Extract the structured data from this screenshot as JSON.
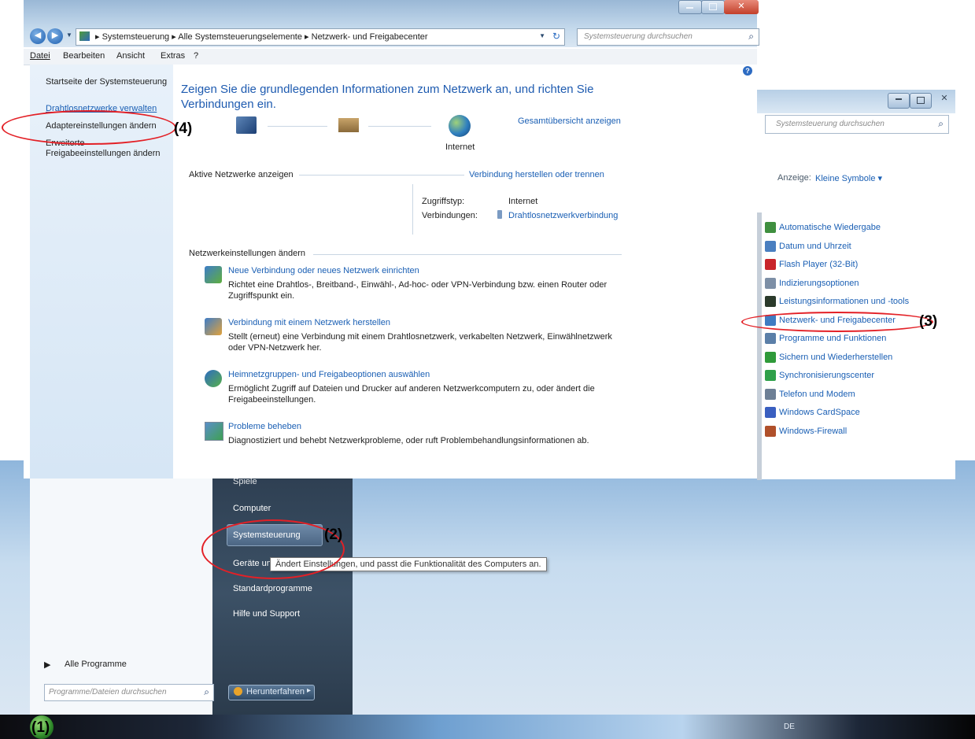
{
  "main_window": {
    "breadcrumb": [
      "Systemsteuerung",
      "Alle Systemsteuerungselemente",
      "Netzwerk- und Freigabecenter"
    ],
    "search_placeholder": "Systemsteuerung durchsuchen",
    "menu": [
      "Datei",
      "Bearbeiten",
      "Ansicht",
      "Extras",
      "?"
    ],
    "sidebar": {
      "items": [
        "Startseite der Systemsteuerung",
        "Drahtlosnetzwerke verwalten",
        "Adaptereinstellungen ändern",
        "Erweiterte",
        "Freigabeeinstellungen ändern"
      ]
    },
    "heading_line1": "Zeigen Sie die grundlegenden Informationen zum Netzwerk an, und richten Sie",
    "heading_line2": "Verbindungen ein.",
    "overview_link": "Gesamtübersicht anzeigen",
    "internet_label": "Internet",
    "active_networks": {
      "label": "Aktive Netzwerke anzeigen",
      "connect_link": "Verbindung herstellen oder trennen",
      "access_type_label": "Zugriffstyp:",
      "access_type_value": "Internet",
      "connections_label": "Verbindungen:",
      "connections_value": "Drahtlosnetzwerkverbindung"
    },
    "settings": {
      "label": "Netzwerkeinstellungen ändern",
      "items": [
        {
          "title": "Neue Verbindung oder neues Netzwerk einrichten",
          "desc1": "Richtet eine Drahtlos-, Breitband-, Einwähl-, Ad-hoc- oder VPN-Verbindung bzw. einen Router oder",
          "desc2": "Zugriffspunkt ein."
        },
        {
          "title": "Verbindung mit einem Netzwerk herstellen",
          "desc1": "Stellt (erneut) eine Verbindung mit einem Drahtlosnetzwerk, verkabelten Netzwerk, Einwählnetzwerk",
          "desc2": "oder VPN-Netzwerk her."
        },
        {
          "title": "Heimnetzgruppen- und Freigabeoptionen auswählen",
          "desc1": "Ermöglicht Zugriff auf Dateien und Drucker auf anderen Netzwerkcomputern zu, oder ändert die",
          "desc2": "Freigabeeinstellungen."
        },
        {
          "title": "Probleme beheben",
          "desc1": "Diagnostiziert und behebt Netzwerkprobleme, oder ruft Problembehandlungsinformationen ab.",
          "desc2": ""
        }
      ]
    }
  },
  "control_panel_window": {
    "search_placeholder": "Systemsteuerung durchsuchen",
    "view_label": "Anzeige:",
    "view_value": "Kleine Symbole",
    "items": [
      "Automatische Wiedergabe",
      "Datum und Uhrzeit",
      "Flash Player (32-Bit)",
      "Indizierungsoptionen",
      "Leistungsinformationen und -tools",
      "Netzwerk- und Freigabecenter",
      "Programme und Funktionen",
      "Sichern und Wiederherstellen",
      "Synchronisierungscenter",
      "Telefon und Modem",
      "Windows CardSpace",
      "Windows-Firewall"
    ],
    "icon_colors": [
      "#3f8f3f",
      "#4a7fc0",
      "#c8242a",
      "#7d8fa6",
      "#2b3a2b",
      "#3e7cc2",
      "#5b7fa8",
      "#2f9a3a",
      "#2fa04a",
      "#6d7f95",
      "#3a5fc0",
      "#b0502a"
    ]
  },
  "start_menu": {
    "items": [
      "Spiele",
      "Computer",
      "Systemsteuerung",
      "Geräte und",
      "Standardprogramme",
      "Hilfe und Support"
    ],
    "all_programs": "Alle Programme",
    "search_placeholder": "Programme/Dateien durchsuchen",
    "shutdown": "Herunterfahren",
    "tooltip": "Ändert Einstellungen, und passt die Funktionalität des Computers an."
  },
  "taskbar": {
    "language": "DE"
  },
  "annotations": [
    "(1)",
    "(2)",
    "(3)",
    "(4)"
  ],
  "colors": {
    "link": "#1a5fb4",
    "annotation_ring": "#e32026",
    "heading": "#1e5bb0"
  }
}
